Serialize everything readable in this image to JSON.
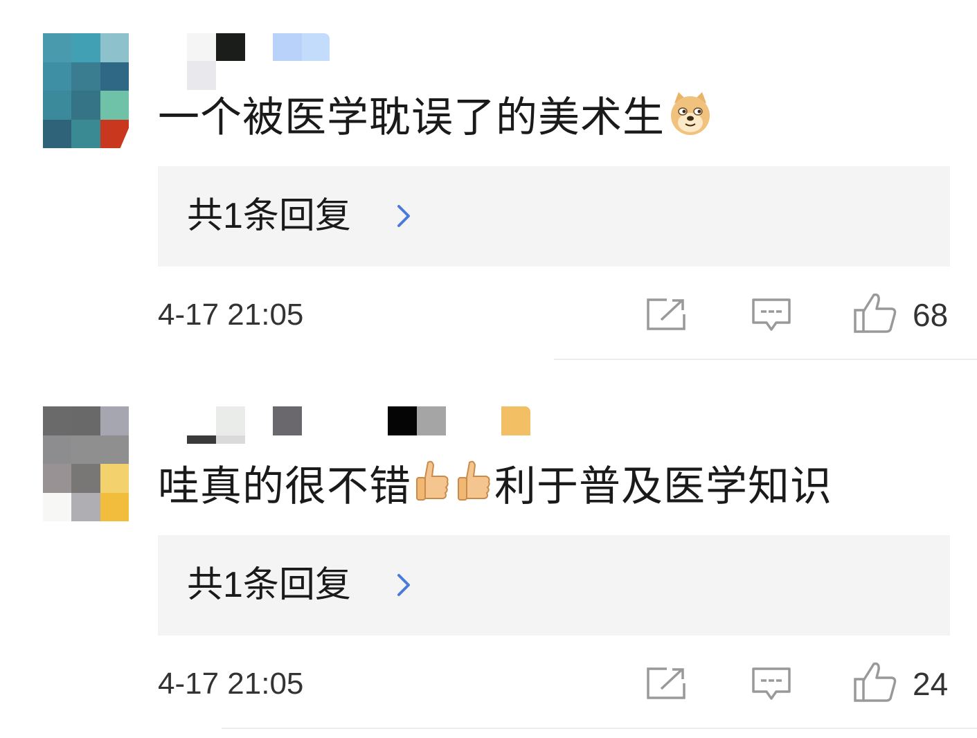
{
  "comments": [
    {
      "text_before": "一个被医学耽误了的美术生",
      "emoji_after": "doge-emoji",
      "reply_label": "共1条回复",
      "timestamp": "4-17 21:05",
      "like_count": "68"
    },
    {
      "text_before": "哇真的很不错",
      "emoji_between": [
        "thumbs-up-emoji",
        "thumbs-up-emoji"
      ],
      "text_after": "利于普及医学知识",
      "reply_label": "共1条回复",
      "timestamp": "4-17 21:05",
      "like_count": "24"
    }
  ],
  "colors": {
    "reply_box_bg": "#f4f4f4",
    "chevron": "#4a7bd8",
    "icon_gray": "#999999"
  }
}
